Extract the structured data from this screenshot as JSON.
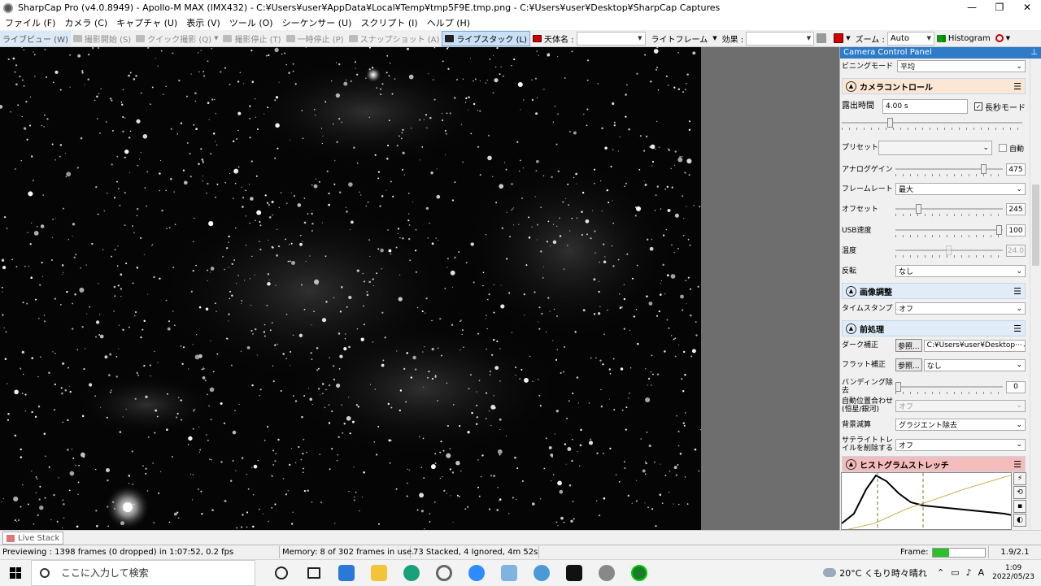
{
  "window": {
    "title": "SharpCap Pro (v4.0.8949) - Apollo-M MAX (IMX432) - C:¥Users¥user¥AppData¥Local¥Temp¥tmp5F9E.tmp.png - C:¥Users¥user¥Desktop¥SharpCap Captures",
    "minimize": "—",
    "maximize": "❐",
    "close": "✕"
  },
  "menu": [
    "ファイル (F)",
    "カメラ (C)",
    "キャプチャ (U)",
    "表示 (V)",
    "ツール (O)",
    "シーケンサー (U)",
    "スクリプト (I)",
    "ヘルプ (H)"
  ],
  "toolbar": {
    "live_view": "ライブビュー (W)",
    "start_capture": "撮影開始 (S)",
    "quick_capture": "クイック撮影 (Q)",
    "stop_capture": "撮影停止 (T)",
    "pause": "一時停止 (P)",
    "snapshot": "スナップショット (A)",
    "live_stack": "ライブスタック (L)",
    "target_label": "天体名 :",
    "target_value": "",
    "light_frame": "ライトフレーム",
    "effect_label": "効果 :",
    "effect_value": "",
    "zoom_label": "ズーム :",
    "zoom_value": "Auto",
    "histogram": "Histogram"
  },
  "panel": {
    "title": "Camera Control Panel",
    "pin": "⊥",
    "binning_label": "ビニングモード",
    "binning_value": "平均",
    "camera_section": "カメラコントロール",
    "exposure_label": "露出時間",
    "exposure_value": "4.00 s",
    "long_mode_label": "長秒モード",
    "long_mode_checked": true,
    "preset_label": "プリセット",
    "preset_value": "",
    "auto_label": "自動",
    "gain_label": "アナログゲイン",
    "gain_value": "475",
    "gain_level": 0.85,
    "framerate_label": "フレームレート",
    "framerate_value": "最大",
    "offset_label": "オフセット",
    "offset_value": "245",
    "offset_level": 0.2,
    "usb_label": "USB速度",
    "usb_value": "100",
    "usb_level": 1.0,
    "temp_label": "温度",
    "temp_value": "24.0",
    "temp_level": 0.5,
    "flip_label": "反転",
    "flip_value": "なし",
    "image_section": "画像調整",
    "timestamp_label": "タイムスタンプ",
    "timestamp_value": "オフ",
    "preprocess_section": "前処理",
    "dark_label": "ダーク補正",
    "dark_button": "参照...",
    "dark_value": "C:¥Users¥user¥Desktop···",
    "flat_label": "フラット補正",
    "flat_button": "参照...",
    "flat_value": "なし",
    "banding_label": "バンディング除去",
    "banding_value": "0",
    "banding_level": 0.0,
    "autoalign_label": "自動位置合わせ (恒星/銀河)",
    "autoalign_value": "オフ",
    "bg_label": "背景減算",
    "bg_value": "グラジエント除去",
    "satellite_label": "サテライトトレイルを削除する",
    "satellite_value": "オフ",
    "histogram_section": "ヒストグラムストレッチ"
  },
  "bottom_tab": "Live Stack",
  "status": {
    "preview": "Previewing : 1398 frames (0 dropped) in 1:07:52, 0.2 fps",
    "memory": "Memory: 8 of 302 frames in use.",
    "stacked": "73 Stacked, 4 Ignored, 4m 52s",
    "frame_label": "Frame:",
    "frame_progress": 0.32,
    "frame_rate": "1.9/2.1"
  },
  "taskbar": {
    "search_placeholder": "ここに入力して検索",
    "weather": "20°C くもり時々晴れ",
    "ime": "A",
    "time": "1:09",
    "date": "2022/05/23"
  },
  "colors": {
    "panel_title_bg": "#2d7bc9",
    "camera_section_bg": "#fbe7d3",
    "image_section_bg": "#e0ecf8",
    "preprocess_section_bg": "#e0ecf8",
    "histogram_section_bg": "#f5bcbc",
    "live_stack_selected": "#c9e0f7",
    "frame_fill": "#2cc02c"
  }
}
